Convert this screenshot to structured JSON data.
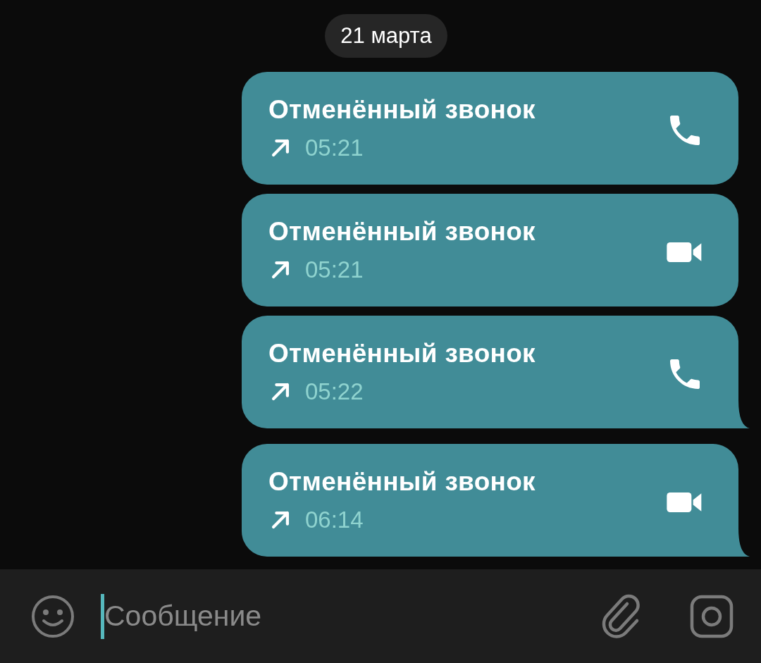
{
  "date_separator": "21 марта",
  "messages": [
    {
      "title": "Отменённый звонок",
      "time": "05:21",
      "kind": "voice",
      "tail": false
    },
    {
      "title": "Отменённый звонок",
      "time": "05:21",
      "kind": "video",
      "tail": false
    },
    {
      "title": "Отменённый звонок",
      "time": "05:22",
      "kind": "voice",
      "tail": true
    },
    {
      "title": "Отменённый звонок",
      "time": "06:14",
      "kind": "video",
      "tail": true
    }
  ],
  "composer": {
    "placeholder": "Сообщение"
  }
}
